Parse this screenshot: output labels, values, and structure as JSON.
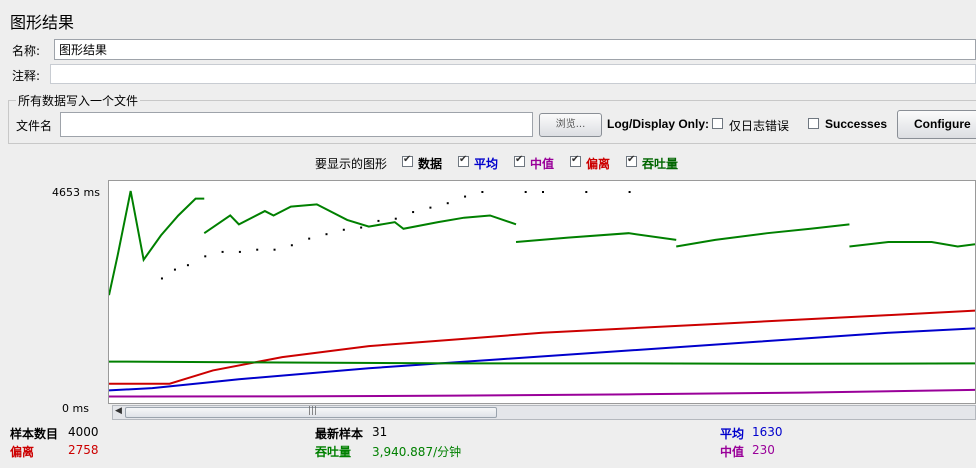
{
  "panel": {
    "title": "图形结果"
  },
  "name_field": {
    "label": "名称:",
    "value": "图形结果"
  },
  "comment_field": {
    "label": "注释:",
    "value": ""
  },
  "file_group": {
    "title": "所有数据写入一个文件",
    "filename_label": "文件名",
    "filename_value": "",
    "browse_label": "浏览...",
    "log_display_label": "Log/Display Only:",
    "errors_only_label": "仅日志错误",
    "errors_only_checked": false,
    "successes_label": "Successes",
    "successes_checked": false,
    "configure_label": "Configure"
  },
  "graphs_to_display": {
    "label": "要显示的图形",
    "items": [
      {
        "label": "数据",
        "checked": true,
        "color": "#000000"
      },
      {
        "label": "平均",
        "checked": true,
        "color": "#0000cc"
      },
      {
        "label": "中值",
        "checked": true,
        "color": "#990099"
      },
      {
        "label": "偏离",
        "checked": true,
        "color": "#cc0000"
      },
      {
        "label": "吞吐量",
        "checked": true,
        "color": "#006600"
      }
    ]
  },
  "chart_data": {
    "type": "line",
    "y_max_label": "4653  ms",
    "y_min_label": "0  ms",
    "ylim": [
      0,
      4653
    ],
    "x_samples": [
      0,
      1,
      2,
      3,
      4,
      5,
      6,
      7,
      8,
      9,
      10,
      11,
      12,
      13,
      14,
      15,
      16,
      17,
      18,
      19,
      20,
      21,
      22,
      23,
      24,
      25,
      26,
      27,
      28,
      29,
      30,
      31,
      32,
      33,
      34,
      35,
      36,
      37,
      38,
      39,
      40
    ],
    "series": [
      {
        "name": "吞吐量",
        "color": "#008000",
        "type": "segments",
        "segments": [
          [
            [
              0,
              2300
            ],
            [
              2,
              3200
            ],
            [
              5,
              4653
            ],
            [
              8,
              3100
            ],
            [
              12,
              3650
            ],
            [
              16,
              4100
            ],
            [
              20,
              4480
            ],
            [
              22,
              4480
            ]
          ],
          [
            [
              22,
              3700
            ],
            [
              28,
              4100
            ],
            [
              30,
              3900
            ],
            [
              36,
              4200
            ],
            [
              38,
              4100
            ],
            [
              42,
              4300
            ],
            [
              48,
              4350
            ],
            [
              55,
              4000
            ],
            [
              60,
              3850
            ],
            [
              66,
              3950
            ],
            [
              68,
              3800
            ],
            [
              76,
              3950
            ],
            [
              82,
              4050
            ],
            [
              88,
              4100
            ],
            [
              94,
              3900
            ]
          ],
          [
            [
              94,
              3500
            ],
            [
              106,
              3600
            ],
            [
              120,
              3700
            ],
            [
              131,
              3550
            ]
          ],
          [
            [
              131,
              3400
            ],
            [
              140,
              3550
            ],
            [
              152,
              3700
            ],
            [
              162,
              3800
            ],
            [
              171,
              3900
            ]
          ],
          [
            [
              171,
              3400
            ],
            [
              180,
              3500
            ],
            [
              190,
              3500
            ],
            [
              196,
              3400
            ],
            [
              200,
              3450
            ]
          ]
        ]
      },
      {
        "name": "数据",
        "color": "#000000",
        "type": "scatter",
        "points": [
          [
            12,
            2700
          ],
          [
            15,
            2900
          ],
          [
            18,
            3000
          ],
          [
            22,
            3200
          ],
          [
            26,
            3300
          ],
          [
            30,
            3300
          ],
          [
            34,
            3350
          ],
          [
            38,
            3350
          ],
          [
            42,
            3450
          ],
          [
            46,
            3600
          ],
          [
            50,
            3700
          ],
          [
            54,
            3800
          ],
          [
            58,
            3850
          ],
          [
            62,
            4000
          ],
          [
            66,
            4050
          ],
          [
            70,
            4200
          ],
          [
            74,
            4300
          ],
          [
            78,
            4400
          ],
          [
            82,
            4550
          ],
          [
            86,
            4653
          ],
          [
            96,
            4653
          ],
          [
            100,
            4653
          ],
          [
            110,
            4653
          ],
          [
            120,
            4653
          ]
        ]
      },
      {
        "name": "偏离",
        "color": "#cc0000",
        "type": "line",
        "points": [
          [
            0,
            300
          ],
          [
            14,
            300
          ],
          [
            24,
            600
          ],
          [
            40,
            900
          ],
          [
            60,
            1150
          ],
          [
            80,
            1300
          ],
          [
            100,
            1450
          ],
          [
            120,
            1550
          ],
          [
            140,
            1650
          ],
          [
            160,
            1750
          ],
          [
            180,
            1850
          ],
          [
            200,
            1950
          ]
        ]
      },
      {
        "name": "平均",
        "color": "#0000cc",
        "type": "line",
        "points": [
          [
            0,
            150
          ],
          [
            10,
            200
          ],
          [
            30,
            400
          ],
          [
            60,
            650
          ],
          [
            90,
            850
          ],
          [
            120,
            1050
          ],
          [
            150,
            1250
          ],
          [
            180,
            1450
          ],
          [
            200,
            1550
          ]
        ]
      },
      {
        "name": "中值",
        "color": "#990099",
        "type": "line",
        "points": [
          [
            0,
            10
          ],
          [
            40,
            15
          ],
          [
            80,
            30
          ],
          [
            120,
            60
          ],
          [
            160,
            100
          ],
          [
            200,
            160
          ]
        ]
      },
      {
        "name": "吞吐量-flat",
        "color": "#008000",
        "type": "line",
        "points": [
          [
            0,
            800
          ],
          [
            40,
            780
          ],
          [
            80,
            760
          ],
          [
            120,
            760
          ],
          [
            160,
            750
          ],
          [
            200,
            760
          ]
        ]
      }
    ],
    "x_range": [
      0,
      200
    ]
  },
  "stats": {
    "samples_label": "样本数目",
    "samples_value": "4000",
    "latest_label": "最新样本",
    "latest_value": "31",
    "average_label": "平均",
    "average_value": "1630",
    "deviation_label": "偏离",
    "deviation_value": "2758",
    "throughput_label": "吞吐量",
    "throughput_value": "3,940.887/分钟",
    "median_label": "中值",
    "median_value": "230"
  }
}
